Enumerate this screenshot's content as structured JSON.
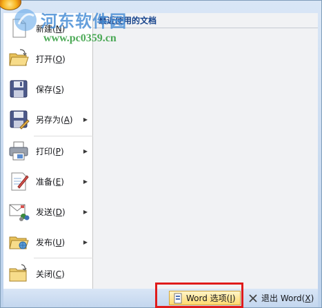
{
  "watermark": {
    "title": "河东软件园",
    "url": "www.pc0359.cn"
  },
  "menu": {
    "items": [
      {
        "name": "new",
        "label": "新建(",
        "key": "N",
        "suffix": ")",
        "has_arrow": false,
        "icon": "new-document-icon"
      },
      {
        "name": "open",
        "label": "打开(",
        "key": "O",
        "suffix": ")",
        "has_arrow": false,
        "icon": "folder-open-icon"
      },
      {
        "name": "save",
        "label": "保存(",
        "key": "S",
        "suffix": ")",
        "has_arrow": false,
        "icon": "floppy-disk-icon"
      },
      {
        "name": "save-as",
        "label": "另存为(",
        "key": "A",
        "suffix": ")",
        "has_arrow": true,
        "icon": "save-as-icon"
      },
      {
        "name": "print",
        "label": "打印(",
        "key": "P",
        "suffix": ")",
        "has_arrow": true,
        "icon": "printer-icon"
      },
      {
        "name": "prepare",
        "label": "准备(",
        "key": "E",
        "suffix": ")",
        "has_arrow": true,
        "icon": "prepare-document-icon"
      },
      {
        "name": "send",
        "label": "发送(",
        "key": "D",
        "suffix": ")",
        "has_arrow": true,
        "icon": "send-mail-icon"
      },
      {
        "name": "publish",
        "label": "发布(",
        "key": "U",
        "suffix": ")",
        "has_arrow": true,
        "icon": "publish-folder-icon"
      },
      {
        "name": "close",
        "label": "关闭(",
        "key": "C",
        "suffix": ")",
        "has_arrow": false,
        "icon": "close-folder-icon"
      }
    ],
    "arrow_glyph": "▶"
  },
  "recent": {
    "header": "最近使用的文档"
  },
  "bottom": {
    "options_label": "Word 选项(",
    "options_key": "I",
    "options_suffix": ")",
    "exit_label": "退出 Word(",
    "exit_key": "X",
    "exit_suffix": ")"
  },
  "colors": {
    "accent": "#15428b",
    "highlight": "#e01b1b",
    "options_bg": "#ffd96e"
  }
}
